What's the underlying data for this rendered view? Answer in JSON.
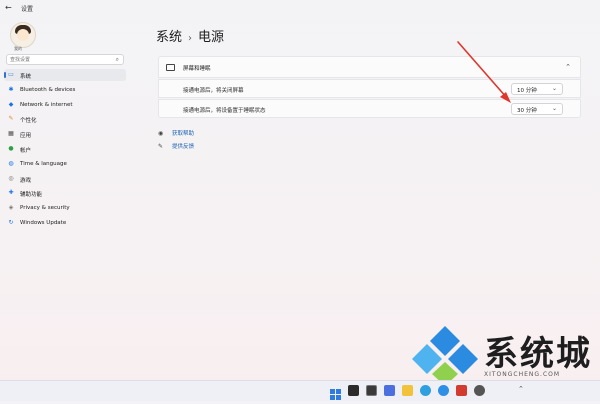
{
  "window": {
    "title": "设置",
    "back_icon": "arrow-left-icon"
  },
  "user": {
    "caption": "我的"
  },
  "search": {
    "placeholder": "查找设置"
  },
  "sidebar": {
    "items": [
      {
        "label": "系统",
        "icon": "system-icon",
        "active": true,
        "color": "#2f6fd6"
      },
      {
        "label": "Bluetooth & devices",
        "icon": "bluetooth-icon",
        "color": "#1a73e8"
      },
      {
        "label": "Network & internet",
        "icon": "wifi-icon",
        "color": "#1a73e8"
      },
      {
        "label": "个性化",
        "icon": "brush-icon",
        "color": "#d98a2b"
      },
      {
        "label": "应用",
        "icon": "apps-icon",
        "color": "#4a4a4a"
      },
      {
        "label": "帐户",
        "icon": "account-icon",
        "color": "#2ea043"
      },
      {
        "label": "Time & language",
        "icon": "globe-icon",
        "color": "#1a73e8"
      },
      {
        "label": "游戏",
        "icon": "game-icon",
        "color": "#666666"
      },
      {
        "label": "辅助功能",
        "icon": "accessibility-icon",
        "color": "#1a73e8"
      },
      {
        "label": "Privacy & security",
        "icon": "shield-icon",
        "color": "#777777"
      },
      {
        "label": "Windows Update",
        "icon": "update-icon",
        "color": "#1a73e8"
      }
    ]
  },
  "header": {
    "parent": "系统",
    "separator": "›",
    "current": "电源"
  },
  "screen_sleep": {
    "title": "屏幕和睡眠",
    "rows": [
      {
        "label": "接通电源后，将关闭屏幕",
        "value": "10 分钟"
      },
      {
        "label": "接通电源后，将设备置于睡眠状态",
        "value": "30 分钟"
      }
    ]
  },
  "help_links": {
    "get_help": "获取帮助",
    "feedback": "提供反馈"
  },
  "watermark": {
    "text": "系统城",
    "subtext": "XITONGCHENG.COM"
  },
  "colors": {
    "accent": "#2f6fd6",
    "link": "#1a5fb4"
  }
}
